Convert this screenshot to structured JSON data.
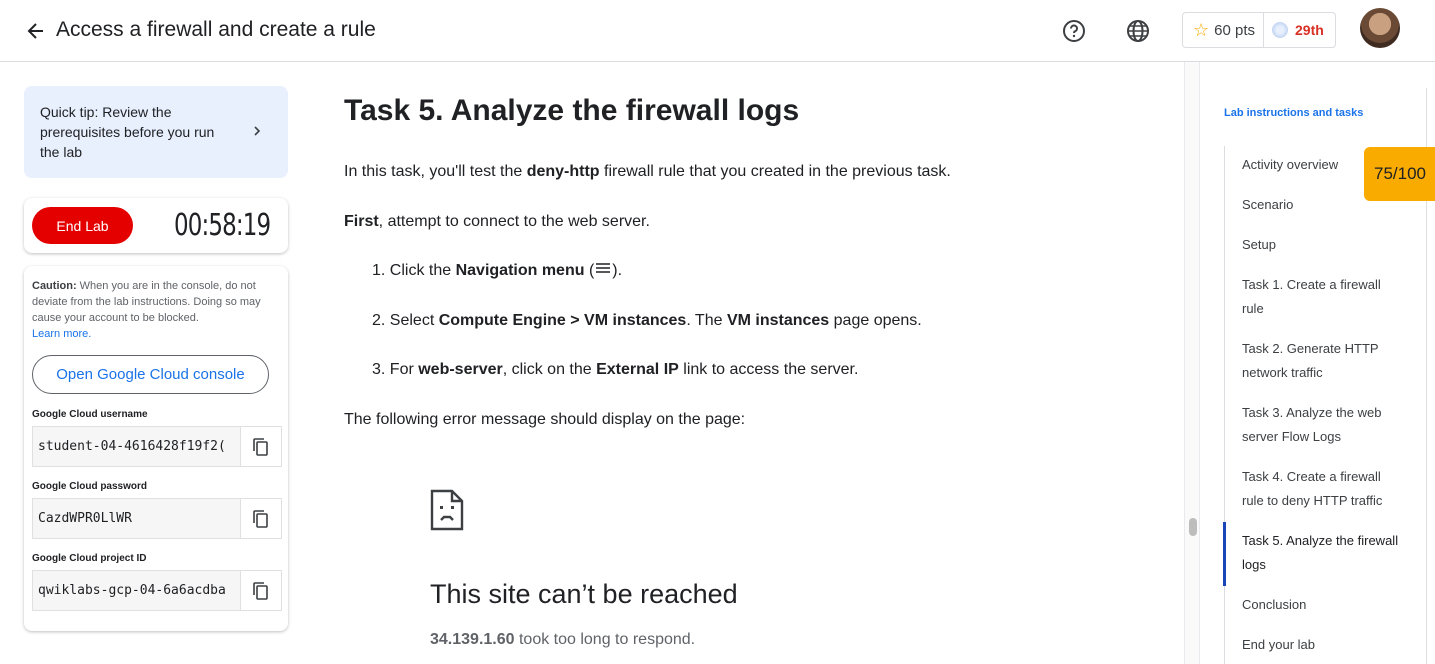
{
  "header": {
    "title": "Access a firewall and create a rule",
    "points": "60 pts",
    "rank": "29th"
  },
  "left_panel": {
    "tip": "Quick tip: Review the prerequisites before you run the lab",
    "end_lab_label": "End Lab",
    "timer": "00:58:19",
    "caution_bold": "Caution:",
    "caution_text": " When you are in the console, do not deviate from the lab instructions. Doing so may cause your account to be blocked.",
    "learn_more": "Learn more.",
    "console_button": "Open Google Cloud console",
    "username_label": "Google Cloud username",
    "username_value": "student-04-4616428f19f2(",
    "password_label": "Google Cloud password",
    "password_value": "CazdWPR0LlWR",
    "project_label": "Google Cloud project ID",
    "project_value": "qwiklabs-gcp-04-6a6acdba"
  },
  "main": {
    "heading": "Task 5. Analyze the firewall logs",
    "intro_pre": "In this task, you'll test the ",
    "intro_bold": "deny-http",
    "intro_post": " firewall rule that you created in the previous task.",
    "first_bold": "First",
    "first_rest": ", attempt to connect to the web server.",
    "step1_pre": "1. Click the ",
    "step1_bold": "Navigation menu",
    "step1_post": " (",
    "step1_end": ").",
    "step2_pre": "2. Select ",
    "step2_bold1": "Compute Engine > VM instances",
    "step2_mid": ". The ",
    "step2_bold2": "VM instances",
    "step2_post": " page opens.",
    "step3_pre": "3. For ",
    "step3_bold1": "web-server",
    "step3_mid": ", click on the ",
    "step3_bold2": "External IP",
    "step3_post": " link to access the server.",
    "following": "The following error message should display on the page:",
    "error_title": "This site can’t be reached",
    "error_ip": "34.139.1.60",
    "error_rest": " took too long to respond."
  },
  "toc": {
    "title": "Lab instructions and tasks",
    "items": [
      "Activity overview",
      "Scenario",
      "Setup",
      "Task 1. Create a firewall rule",
      "Task 2. Generate HTTP network traffic",
      "Task 3. Analyze the web server Flow Logs",
      "Task 4. Create a firewall rule to deny HTTP traffic",
      "Task 5. Analyze the firewall logs",
      "Conclusion",
      "End your lab"
    ],
    "score": "75/100"
  },
  "colors": {
    "accent": "#1a73e8",
    "end_lab": "#e50000",
    "score_badge": "#f9ab00",
    "tip_bg": "#e8f0fe",
    "rank": "#d93025"
  }
}
